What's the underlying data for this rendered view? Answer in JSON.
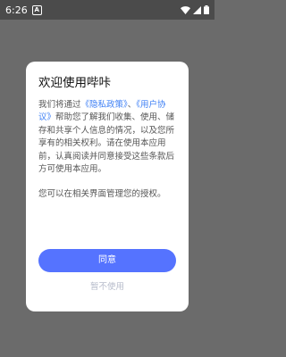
{
  "status_bar": {
    "time": "6:26",
    "notification_label": "A"
  },
  "dialog": {
    "title": "欢迎使用哔咔",
    "body_parts": [
      "我们将通过",
      "《隐私政策》",
      "、",
      "《用户协议》",
      "帮助您了解我们收集、使用、储存和共享个人信息的情况，以及您所享有的相关权利。请在使用本应用前，认真阅读并同意接受这些条款后方可使用本应用。"
    ],
    "body_note": "您可以在相关界面管理您的授权。",
    "agree_label": "同意",
    "decline_label": "暂不使用"
  },
  "colors": {
    "overlay": "#6b6b6b",
    "status_bar": "#4b4b4b",
    "link": "#3d7ff5",
    "accent_button": "#5573ff",
    "decline_text": "#b7bccb"
  }
}
